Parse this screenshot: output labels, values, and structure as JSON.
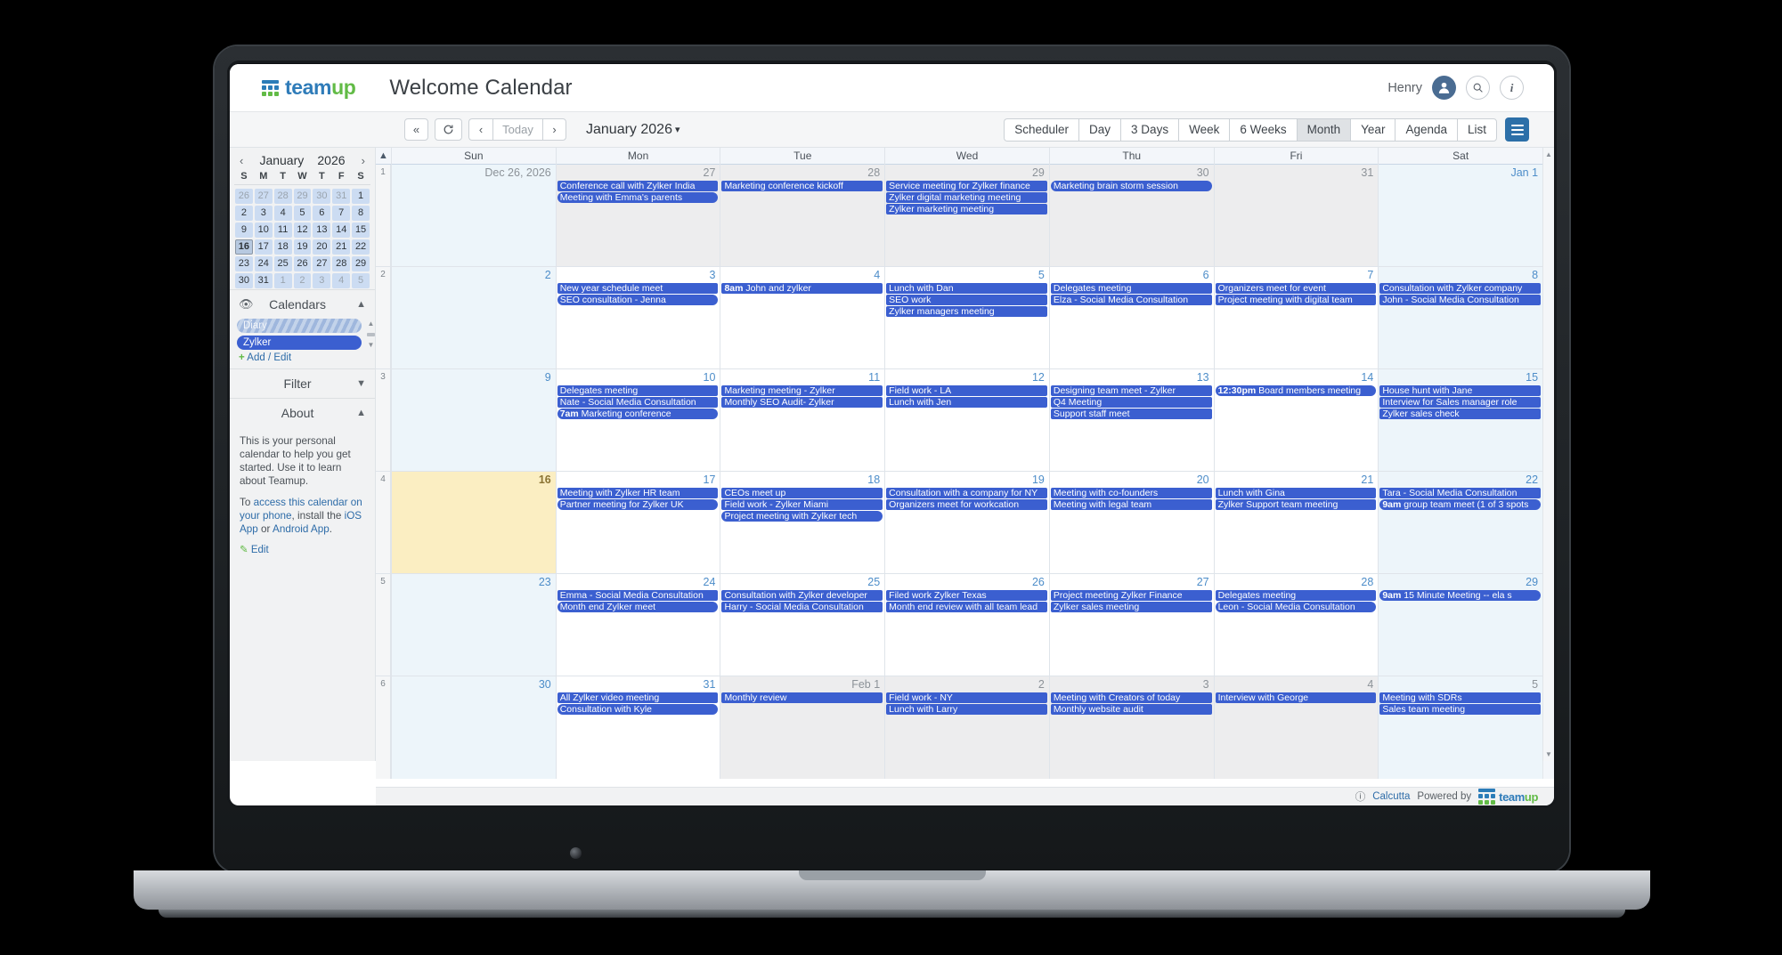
{
  "brand": {
    "name_part1": "team",
    "name_part2": "up",
    "logo_icon": "teamup-dots-icon"
  },
  "header": {
    "calendar_title": "Welcome Calendar",
    "user_name": "Henry",
    "avatar_icon": "user-avatar-icon",
    "search_icon": "search-icon",
    "info_icon": "info-icon"
  },
  "toolbar": {
    "jump_back": "«",
    "refresh_icon": "refresh-icon",
    "prev": "‹",
    "today": "Today",
    "next": "›",
    "current_range": "January 2026",
    "range_chevron": "chevron-down-icon",
    "views": [
      "Scheduler",
      "Day",
      "3 Days",
      "Week",
      "6 Weeks",
      "Month",
      "Year",
      "Agenda",
      "List"
    ],
    "active_view": "Month",
    "menu_icon": "hamburger-menu-icon"
  },
  "sidebar": {
    "mini_calendar": {
      "prev_icon": "chevron-left-icon",
      "next_icon": "chevron-right-icon",
      "month": "January",
      "year": "2026",
      "dow": [
        "S",
        "M",
        "T",
        "W",
        "T",
        "F",
        "S"
      ],
      "weeks": [
        [
          {
            "d": "26",
            "out": true
          },
          {
            "d": "27",
            "out": true
          },
          {
            "d": "28",
            "out": true
          },
          {
            "d": "29",
            "out": true
          },
          {
            "d": "30",
            "out": true
          },
          {
            "d": "31",
            "out": true
          },
          {
            "d": "1",
            "out": false
          }
        ],
        [
          {
            "d": "2"
          },
          {
            "d": "3"
          },
          {
            "d": "4"
          },
          {
            "d": "5"
          },
          {
            "d": "6"
          },
          {
            "d": "7"
          },
          {
            "d": "8"
          }
        ],
        [
          {
            "d": "9"
          },
          {
            "d": "10"
          },
          {
            "d": "11"
          },
          {
            "d": "12"
          },
          {
            "d": "13"
          },
          {
            "d": "14"
          },
          {
            "d": "15"
          }
        ],
        [
          {
            "d": "16",
            "today": true
          },
          {
            "d": "17"
          },
          {
            "d": "18"
          },
          {
            "d": "19"
          },
          {
            "d": "20"
          },
          {
            "d": "21"
          },
          {
            "d": "22"
          }
        ],
        [
          {
            "d": "23"
          },
          {
            "d": "24"
          },
          {
            "d": "25"
          },
          {
            "d": "26"
          },
          {
            "d": "27"
          },
          {
            "d": "28"
          },
          {
            "d": "29"
          }
        ],
        [
          {
            "d": "30"
          },
          {
            "d": "31"
          },
          {
            "d": "1",
            "out": true
          },
          {
            "d": "2",
            "out": true
          },
          {
            "d": "3",
            "out": true
          },
          {
            "d": "4",
            "out": true
          },
          {
            "d": "5",
            "out": true
          }
        ]
      ]
    },
    "calendars_section": {
      "eye_icon": "eye-icon",
      "title": "Calendars",
      "chevron": "chevron-up-icon",
      "items": [
        {
          "label": "Diary",
          "color": "#9fb7dd",
          "style": "striped"
        },
        {
          "label": "Zylker",
          "color": "#3b5fd0",
          "style": "solid"
        }
      ],
      "add_edit": "Add / Edit",
      "add_icon": "plus-icon"
    },
    "filter_section": {
      "title": "Filter",
      "chevron": "chevron-down-icon"
    },
    "about_section": {
      "title": "About",
      "chevron": "chevron-up-icon",
      "paragraph1": "This is your personal calendar to help you get started. Use it to learn about Teamup.",
      "p2_prefix": "To ",
      "p2_link1": "access this calendar on your phone",
      "p2_mid": ", install the ",
      "p2_link2": "iOS App",
      "p2_or": " or ",
      "p2_link3": "Android App",
      "p2_end": ".",
      "edit_label": "Edit",
      "edit_icon": "pencil-icon"
    }
  },
  "grid": {
    "collapse_icon": "collapse-up-icon",
    "day_headers": [
      "Sun",
      "Mon",
      "Tue",
      "Wed",
      "Thu",
      "Fri",
      "Sat"
    ],
    "weeks": [
      {
        "week_number": "1",
        "days": [
          {
            "label": "Dec 26, 2026",
            "state": "other-weekend",
            "events": []
          },
          {
            "label": "27",
            "state": "other",
            "events": [
              {
                "title": "Conference call with Zylker India",
                "cal": "zylker"
              },
              {
                "title": "Meeting with Emma's parents",
                "cal": "diary"
              }
            ]
          },
          {
            "label": "28",
            "state": "other",
            "events": [
              {
                "title": "Marketing conference kickoff",
                "cal": "zylker"
              }
            ]
          },
          {
            "label": "29",
            "state": "other",
            "events": [
              {
                "title": "Service meeting for Zylker finance",
                "cal": "zylker"
              },
              {
                "title": "Zylker digital marketing meeting",
                "cal": "zylker"
              },
              {
                "title": "Zylker marketing meeting",
                "cal": "zylker"
              }
            ]
          },
          {
            "label": "30",
            "state": "other",
            "events": [
              {
                "title": "Marketing brain storm session",
                "cal": "diary"
              }
            ]
          },
          {
            "label": "31",
            "state": "other",
            "events": []
          },
          {
            "label": "Jan 1",
            "state": "weekend",
            "events": []
          }
        ]
      },
      {
        "week_number": "2",
        "days": [
          {
            "label": "2",
            "state": "weekend",
            "events": []
          },
          {
            "label": "3",
            "state": "normal",
            "events": [
              {
                "title": "New year schedule meet",
                "cal": "zylker"
              },
              {
                "title": "SEO consultation - Jenna",
                "cal": "diary"
              }
            ]
          },
          {
            "label": "4",
            "state": "normal",
            "events": [
              {
                "time": "8am",
                "title": "John and zylker",
                "cal": "zylker"
              }
            ]
          },
          {
            "label": "5",
            "state": "normal",
            "events": [
              {
                "title": "Lunch with Dan",
                "cal": "zylker"
              },
              {
                "title": "SEO work",
                "cal": "zylker"
              },
              {
                "title": "Zylker managers meeting",
                "cal": "zylker"
              }
            ]
          },
          {
            "label": "6",
            "state": "normal",
            "events": [
              {
                "title": "Delegates meeting",
                "cal": "zylker"
              },
              {
                "title": "Elza - Social Media Consultation",
                "cal": "zylker"
              }
            ]
          },
          {
            "label": "7",
            "state": "normal",
            "events": [
              {
                "title": "Organizers meet for event",
                "cal": "zylker"
              },
              {
                "title": "Project meeting with digital team",
                "cal": "zylker"
              }
            ]
          },
          {
            "label": "8",
            "state": "weekend",
            "events": [
              {
                "title": "Consultation with Zylker company",
                "cal": "zylker"
              },
              {
                "title": "John - Social Media Consultation",
                "cal": "zylker"
              }
            ]
          }
        ]
      },
      {
        "week_number": "3",
        "days": [
          {
            "label": "9",
            "state": "weekend",
            "events": []
          },
          {
            "label": "10",
            "state": "normal",
            "events": [
              {
                "title": "Delegates meeting",
                "cal": "zylker"
              },
              {
                "title": "Nate - Social Media Consultation",
                "cal": "zylker"
              },
              {
                "time": "7am",
                "title": "Marketing conference",
                "cal": "diary"
              }
            ]
          },
          {
            "label": "11",
            "state": "normal",
            "events": [
              {
                "title": "Marketing meeting - Zylker",
                "cal": "zylker"
              },
              {
                "title": "Monthly SEO Audit- Zylker",
                "cal": "zylker"
              }
            ]
          },
          {
            "label": "12",
            "state": "normal",
            "events": [
              {
                "title": "Field work - LA",
                "cal": "zylker"
              },
              {
                "title": "Lunch with Jen",
                "cal": "zylker"
              }
            ]
          },
          {
            "label": "13",
            "state": "normal",
            "events": [
              {
                "title": "Designing team meet - Zylker",
                "cal": "zylker"
              },
              {
                "title": "Q4 Meeting",
                "cal": "zylker"
              },
              {
                "title": "Support staff meet",
                "cal": "zylker"
              }
            ]
          },
          {
            "label": "14",
            "state": "normal",
            "events": [
              {
                "time": "12:30pm",
                "title": "Board members meeting",
                "cal": "diary"
              }
            ]
          },
          {
            "label": "15",
            "state": "weekend",
            "events": [
              {
                "title": "House hunt with Jane",
                "cal": "zylker"
              },
              {
                "title": "Interview for Sales manager role",
                "cal": "zylker"
              },
              {
                "title": "Zylker sales check",
                "cal": "zylker"
              }
            ]
          }
        ]
      },
      {
        "week_number": "4",
        "days": [
          {
            "label": "16",
            "state": "today",
            "events": []
          },
          {
            "label": "17",
            "state": "normal",
            "events": [
              {
                "title": "Meeting with Zylker HR team",
                "cal": "zylker"
              },
              {
                "title": "Partner meeting for Zylker UK",
                "cal": "diary"
              }
            ]
          },
          {
            "label": "18",
            "state": "normal",
            "events": [
              {
                "title": "CEOs meet up",
                "cal": "zylker"
              },
              {
                "title": "Field work - Zylker Miami",
                "cal": "zylker"
              },
              {
                "title": "Project meeting with Zylker tech",
                "cal": "diary"
              }
            ]
          },
          {
            "label": "19",
            "state": "normal",
            "events": [
              {
                "title": "Consultation with a company for NY",
                "cal": "zylker"
              },
              {
                "title": "Organizers meet for workcation",
                "cal": "zylker"
              }
            ]
          },
          {
            "label": "20",
            "state": "normal",
            "events": [
              {
                "title": "Meeting with co-founders",
                "cal": "zylker"
              },
              {
                "title": "Meeting with legal team",
                "cal": "zylker"
              }
            ]
          },
          {
            "label": "21",
            "state": "normal",
            "events": [
              {
                "title": "Lunch with Gina",
                "cal": "zylker"
              },
              {
                "title": "Zylker Support team meeting",
                "cal": "zylker"
              }
            ]
          },
          {
            "label": "22",
            "state": "weekend",
            "events": [
              {
                "title": "Tara - Social Media Consultation",
                "cal": "zylker"
              },
              {
                "time": "9am",
                "title": "group team meet (1 of 3 spots",
                "cal": "diary"
              }
            ]
          }
        ]
      },
      {
        "week_number": "5",
        "days": [
          {
            "label": "23",
            "state": "weekend",
            "events": []
          },
          {
            "label": "24",
            "state": "normal",
            "events": [
              {
                "title": "Emma - Social Media Consultation",
                "cal": "zylker"
              },
              {
                "title": "Month end Zylker meet",
                "cal": "diary"
              }
            ]
          },
          {
            "label": "25",
            "state": "normal",
            "events": [
              {
                "title": "Consultation with Zylker developer",
                "cal": "zylker"
              },
              {
                "title": "Harry - Social Media Consultation",
                "cal": "zylker"
              }
            ]
          },
          {
            "label": "26",
            "state": "normal",
            "events": [
              {
                "title": "Filed work Zylker Texas",
                "cal": "zylker"
              },
              {
                "title": "Month end review with all team lead",
                "cal": "zylker"
              }
            ]
          },
          {
            "label": "27",
            "state": "normal",
            "events": [
              {
                "title": "Project meeting Zylker Finance",
                "cal": "zylker"
              },
              {
                "title": "Zylker sales meeting",
                "cal": "zylker"
              }
            ]
          },
          {
            "label": "28",
            "state": "normal",
            "events": [
              {
                "title": "Delegates meeting",
                "cal": "zylker"
              },
              {
                "title": "Leon - Social Media Consultation",
                "cal": "diary"
              }
            ]
          },
          {
            "label": "29",
            "state": "weekend",
            "events": [
              {
                "time": "9am",
                "title": "15 Minute Meeting -- ela s",
                "cal": "diary"
              }
            ]
          }
        ]
      },
      {
        "week_number": "6",
        "days": [
          {
            "label": "30",
            "state": "weekend",
            "events": []
          },
          {
            "label": "31",
            "state": "normal",
            "events": [
              {
                "title": "All Zylker video meeting",
                "cal": "zylker"
              },
              {
                "title": "Consultation with Kyle",
                "cal": "diary"
              }
            ]
          },
          {
            "label": "Feb 1",
            "state": "other",
            "events": [
              {
                "title": "Monthly review",
                "cal": "zylker"
              }
            ]
          },
          {
            "label": "2",
            "state": "other",
            "events": [
              {
                "title": "Field work - NY",
                "cal": "zylker"
              },
              {
                "title": "Lunch with Larry",
                "cal": "zylker"
              }
            ]
          },
          {
            "label": "3",
            "state": "other",
            "events": [
              {
                "title": "Meeting with Creators of today",
                "cal": "zylker"
              },
              {
                "title": "Monthly website audit",
                "cal": "zylker"
              }
            ]
          },
          {
            "label": "4",
            "state": "other",
            "events": [
              {
                "title": "Interview with George",
                "cal": "zylker"
              }
            ]
          },
          {
            "label": "5",
            "state": "other-weekend",
            "events": [
              {
                "title": "Meeting with SDRs",
                "cal": "zylker"
              },
              {
                "title": "Sales team meeting",
                "cal": "zylker"
              }
            ]
          }
        ]
      }
    ]
  },
  "footer": {
    "timezone_icon": "clock-icon",
    "timezone": "Calcutta",
    "powered_by": "Powered by"
  },
  "colors": {
    "event_blue": "#3b5fd0",
    "today_yellow": "#fbeec2",
    "weekend_blue": "#edf5fa",
    "link_blue": "#2e6ca8",
    "brand_blue": "#2f7cb9",
    "brand_green": "#62bb46"
  }
}
